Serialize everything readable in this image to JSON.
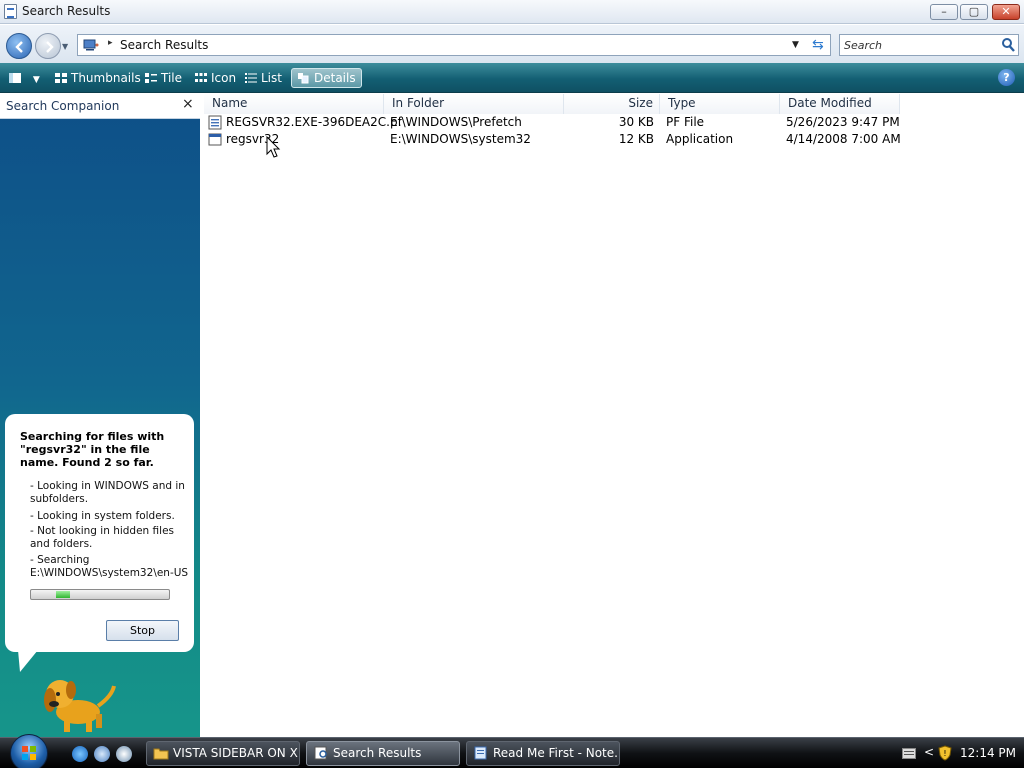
{
  "window": {
    "title": "Search Results",
    "buttons": {
      "minimize": "–",
      "maximize": "▢",
      "close": "✕"
    }
  },
  "address": {
    "path": "Search Results",
    "search_placeholder": "Search"
  },
  "toolbar": {
    "views": [
      {
        "label": "Thumbnails"
      },
      {
        "label": "Tile"
      },
      {
        "label": "Icon"
      },
      {
        "label": "List"
      },
      {
        "label": "Details"
      }
    ],
    "help": "?"
  },
  "companion": {
    "title": "Search Companion",
    "close": "×",
    "headline": "Searching for files with \"regsvr32\" in the file name. Found 2 so far.",
    "lines": [
      "- Looking in WINDOWS and in subfolders.",
      "- Looking in system folders.",
      "- Not looking in hidden files and folders.",
      "- Searching E:\\WINDOWS\\system32\\en-US"
    ],
    "stop_label": "Stop",
    "progress": {
      "start": 0.18,
      "end": 0.28
    }
  },
  "columns": {
    "name": "Name",
    "folder": "In Folder",
    "size": "Size",
    "type": "Type",
    "date": "Date Modified"
  },
  "files": [
    {
      "name": "REGSVR32.EXE-396DEA2C.pf",
      "folder": "E:\\WINDOWS\\Prefetch",
      "size": "30 KB",
      "type": "PF File",
      "date": "5/26/2023 9:47 PM"
    },
    {
      "name": "regsvr32",
      "folder": "E:\\WINDOWS\\system32",
      "size": "12 KB",
      "type": "Application",
      "date": "4/14/2008 7:00 AM"
    }
  ],
  "taskbar": {
    "tasks": [
      {
        "label": "VISTA SIDEBAR ON XP"
      },
      {
        "label": "Search Results"
      },
      {
        "label": "Read Me First - Note..."
      }
    ],
    "clock": "12:14 PM"
  },
  "colors": {
    "toolbar": "#135f73",
    "pane_top": "#0e4f88",
    "pane_bottom": "#16958a"
  }
}
